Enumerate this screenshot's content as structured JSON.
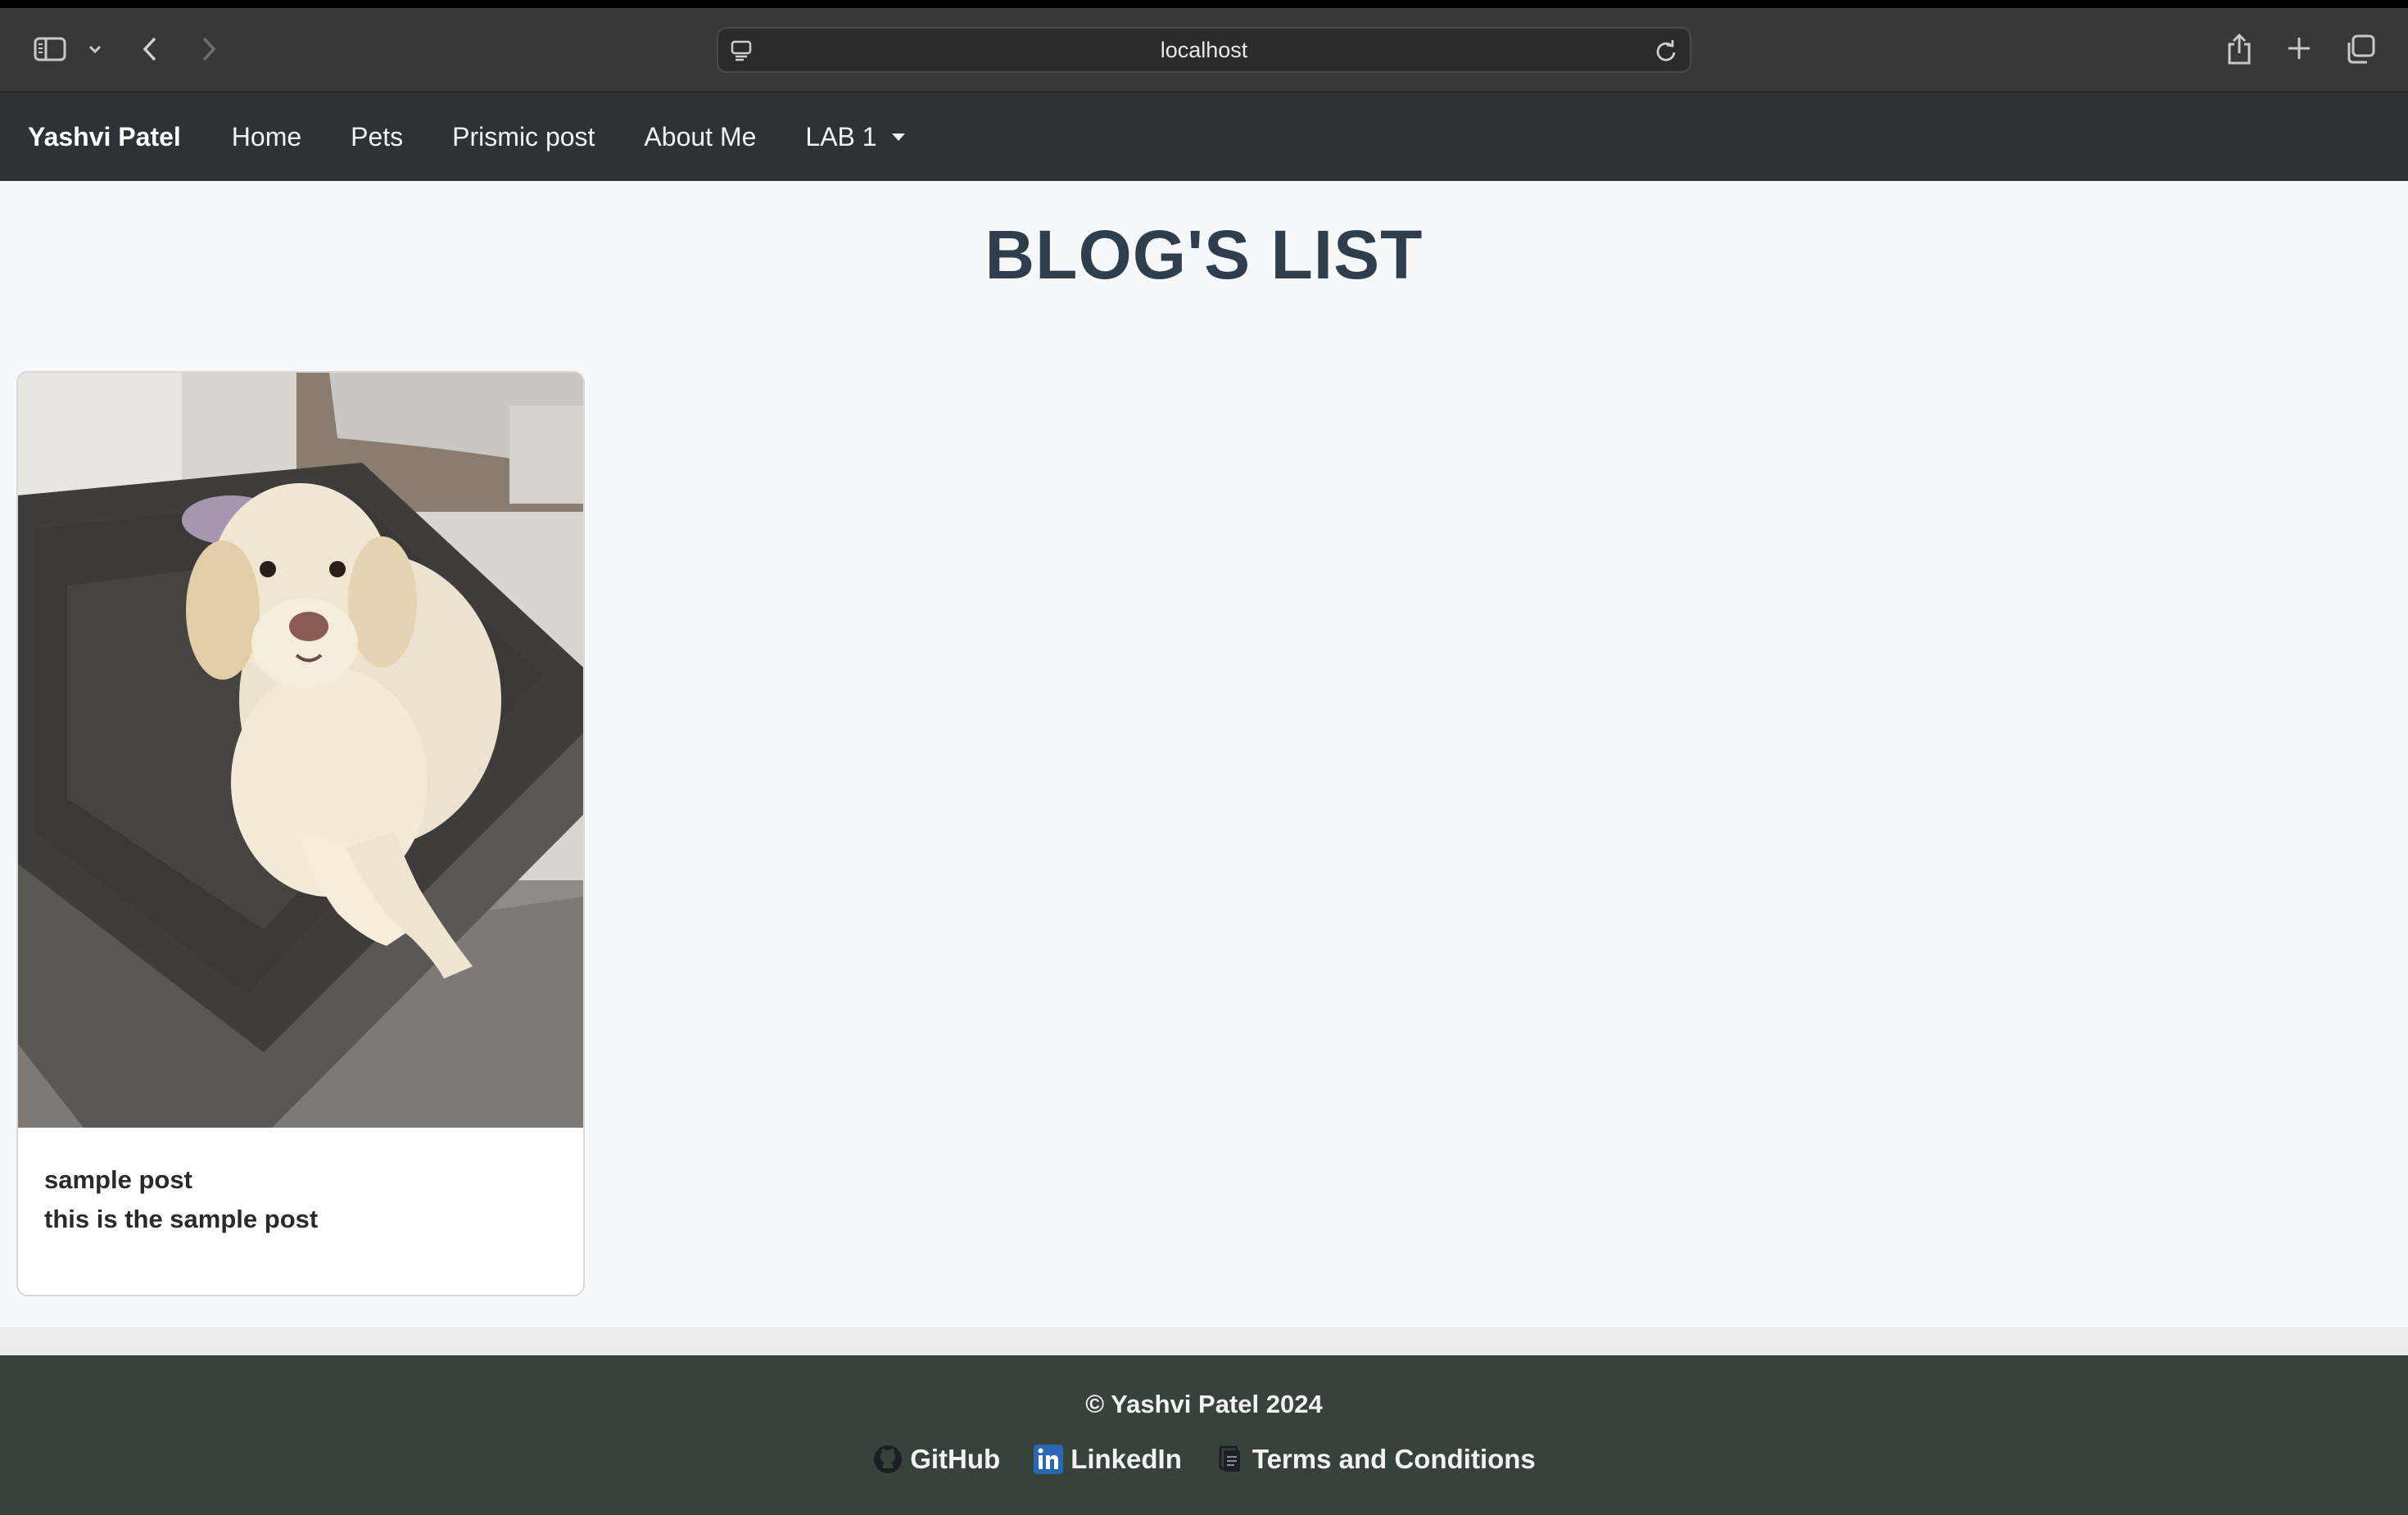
{
  "browser": {
    "url": "localhost"
  },
  "navbar": {
    "brand": "Yashvi Patel",
    "links": [
      "Home",
      "Pets",
      "Prismic post",
      "About Me"
    ],
    "dropdown_label": "LAB 1"
  },
  "main": {
    "title": "BLOG'S LIST",
    "posts": [
      {
        "title": "sample post",
        "text": "this is the sample post",
        "image": "dog-on-bed-photo"
      }
    ]
  },
  "footer": {
    "copyright": "© Yashvi Patel 2024",
    "links": [
      {
        "label": "GitHub",
        "icon": "github-icon"
      },
      {
        "label": "LinkedIn",
        "icon": "linkedin-icon"
      },
      {
        "label": "Terms and Conditions",
        "icon": "document-icon"
      }
    ]
  },
  "colors": {
    "navbar_bg": "#2e3135",
    "footer_bg": "#37423c",
    "title_color": "#2f3e4d",
    "linkedin_blue": "#2867b2"
  }
}
